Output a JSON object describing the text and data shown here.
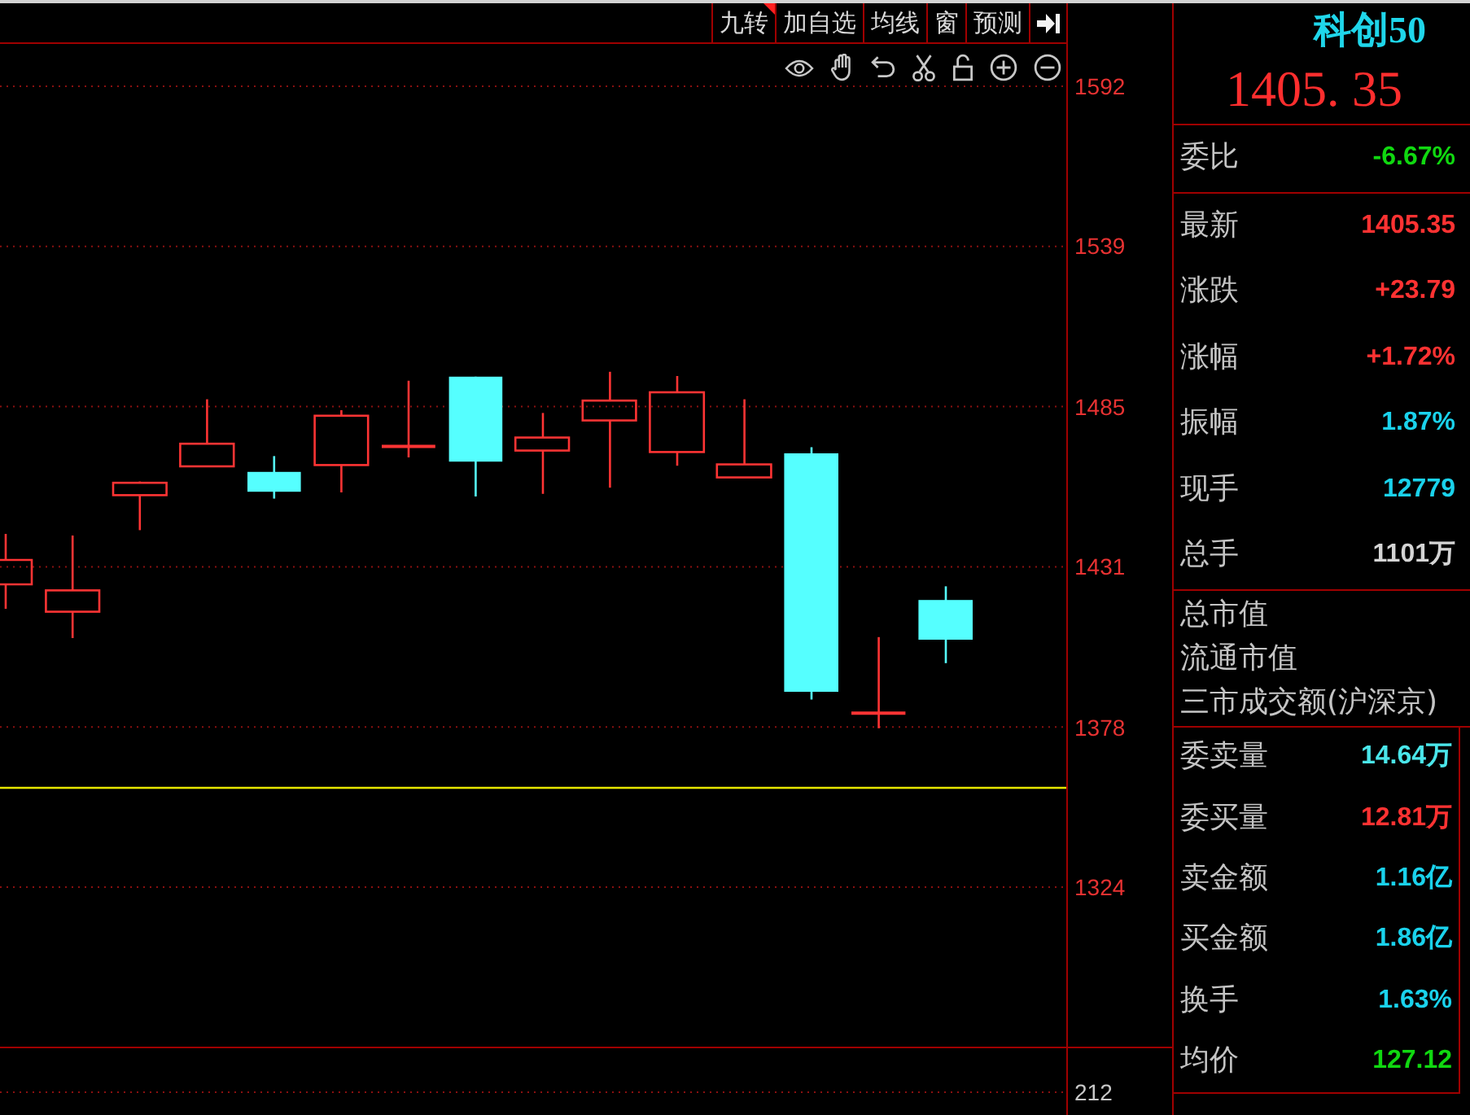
{
  "toolbar": {
    "buttons": [
      {
        "label": "九转",
        "flagged": true
      },
      {
        "label": "加自选",
        "flagged": false
      },
      {
        "label": "均线",
        "flagged": false
      },
      {
        "label": "窗",
        "flagged": false
      },
      {
        "label": "预测",
        "flagged": false
      }
    ]
  },
  "chart": {
    "price_axis": [
      "1592",
      "1539",
      "1485",
      "1431",
      "1378",
      "1324"
    ],
    "volume_axis": "212"
  },
  "quote": {
    "name": "科创50",
    "price": "1405. 35"
  },
  "sections": [
    {
      "kind": "values",
      "rows": [
        {
          "label": "委比",
          "value": "-6.67%",
          "color": "#10d810"
        }
      ]
    },
    {
      "kind": "values",
      "rows": [
        {
          "label": "最新",
          "value": "1405.35",
          "color": "#ff3232"
        },
        {
          "label": "涨跌",
          "value": "+23.79",
          "color": "#ff3232"
        },
        {
          "label": "涨幅",
          "value": "+1.72%",
          "color": "#ff3232"
        },
        {
          "label": "振幅",
          "value": "1.87%",
          "color": "#1ad2ec"
        },
        {
          "label": "现手",
          "value": "12779",
          "color": "#1ad2ec"
        },
        {
          "label": "总手",
          "value": "1101万",
          "color": "#d4d4d4"
        }
      ]
    },
    {
      "kind": "labels",
      "rows": [
        {
          "label": "总市值"
        },
        {
          "label": "流通市值"
        },
        {
          "label": "三市成交额(沪深京)"
        }
      ]
    },
    {
      "kind": "boxed",
      "rows": [
        {
          "label": "委卖量",
          "value": "14.64万",
          "color": "#4ae6ea"
        },
        {
          "label": "委买量",
          "value": "12.81万",
          "color": "#ff3232"
        },
        {
          "label": "卖金额",
          "value": "1.16亿",
          "color": "#1ad2ec"
        },
        {
          "label": "买金额",
          "value": "1.86亿",
          "color": "#1ad2ec"
        },
        {
          "label": "换手",
          "value": "1.63%",
          "color": "#1ad2ec"
        },
        {
          "label": "均价",
          "value": "127.12",
          "color": "#10d810"
        }
      ]
    }
  ]
}
